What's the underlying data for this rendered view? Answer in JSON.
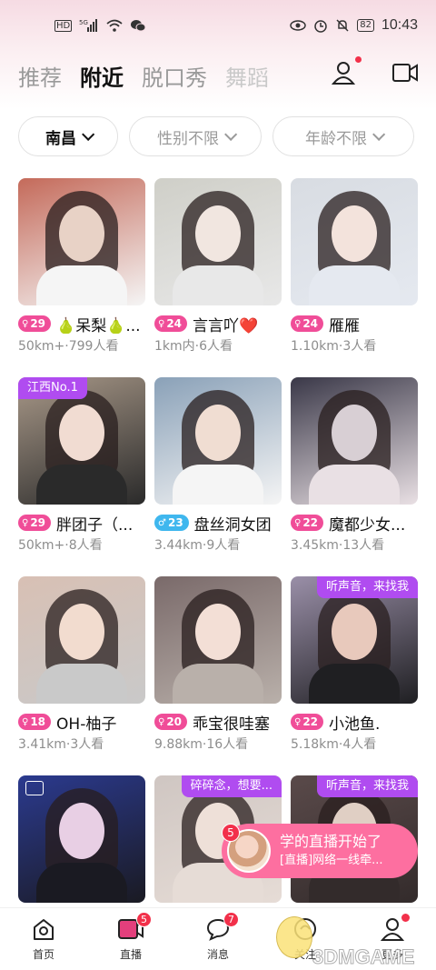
{
  "status_bar": {
    "left_icons": [
      "HD",
      "5G",
      "signal-icon",
      "wifi-icon",
      "wechat-icon"
    ],
    "battery": "82",
    "time": "10:43"
  },
  "tabs": [
    "推荐",
    "附近",
    "脱口秀",
    "舞蹈"
  ],
  "active_tab": "附近",
  "filters": {
    "city": "南昌",
    "gender": "性别不限",
    "age": "年龄不限"
  },
  "cards": [
    {
      "age": "29",
      "gender": "female",
      "name": "🍐呆梨🍐...",
      "meta": "50km+·799人看",
      "tag": "",
      "colors": [
        "#c46a5a",
        "#e8d2c6",
        "#f5f5f5"
      ]
    },
    {
      "age": "24",
      "gender": "female",
      "name": "言言吖❤️",
      "meta": "1km内·6人看",
      "tag": "",
      "colors": [
        "#cfcfc8",
        "#f1e6e0",
        "#e8e8e8"
      ]
    },
    {
      "age": "24",
      "gender": "female",
      "name": "雁雁",
      "meta": "1.10km·3人看",
      "tag": "",
      "colors": [
        "#d8dce2",
        "#f3e3dc",
        "#e5e9f0"
      ]
    },
    {
      "age": "29",
      "gender": "female",
      "name": "胖团子（...",
      "meta": "50km+·8人看",
      "tag": "江西No.1",
      "tag_side": "left",
      "colors": [
        "#a89888",
        "#f1dcd2",
        "#2a2a2a"
      ]
    },
    {
      "age": "23",
      "gender": "male",
      "name": "盘丝洞女团",
      "meta": "3.44km·9人看",
      "tag": "",
      "colors": [
        "#8aa1b8",
        "#f0ddd2",
        "#f5f5f5"
      ]
    },
    {
      "age": "22",
      "gender": "female",
      "name": "魔都少女...",
      "meta": "3.45km·13人看",
      "tag": "",
      "colors": [
        "#3a3848",
        "#d8cfd4",
        "#e9e0e4"
      ]
    },
    {
      "age": "18",
      "gender": "female",
      "name": "OH-柚子",
      "meta": "3.41km·3人看",
      "tag": "",
      "colors": [
        "#d8c0b4",
        "#f2dccf",
        "#c9c9c9"
      ]
    },
    {
      "age": "20",
      "gender": "female",
      "name": "乖宝很哇塞",
      "meta": "9.88km·16人看",
      "tag": "",
      "colors": [
        "#7a6a6a",
        "#f3dfd6",
        "#b9b0aa"
      ]
    },
    {
      "age": "22",
      "gender": "female",
      "name": "小池鱼.",
      "meta": "5.18km·4人看",
      "tag": "听声音，来找我",
      "tag_side": "right",
      "colors": [
        "#9a8fa8",
        "#e8c9bc",
        "#1f1f22"
      ]
    },
    {
      "age": "",
      "gender": "female",
      "name": "",
      "meta": "",
      "tag": "",
      "live_icon": true,
      "colors": [
        "#2b3a8f",
        "#e8cfe4",
        "#1a1a22"
      ]
    },
    {
      "age": "",
      "gender": "female",
      "name": "",
      "meta": "",
      "tag": "碎碎念，想要...",
      "tag_side": "right",
      "colors": [
        "#cfc6c2",
        "#eee0d8",
        "#e6dcd6"
      ]
    },
    {
      "age": "",
      "gender": "female",
      "name": "",
      "meta": "",
      "tag": "听声音，来找我",
      "tag_side": "right",
      "colors": [
        "#5a4a4a",
        "#e0cfc4",
        "#332b2b"
      ]
    }
  ],
  "live_popup": {
    "badge": "5",
    "title": "学的直播开始了",
    "subtitle": "[直播]网络一线牵..."
  },
  "bottom_nav": [
    {
      "label": "首页",
      "icon": "home-icon",
      "badge": ""
    },
    {
      "label": "直播",
      "icon": "live-icon",
      "badge": "5"
    },
    {
      "label": "消息",
      "icon": "message-icon",
      "badge": "7"
    },
    {
      "label": "关注",
      "icon": "follow-icon",
      "badge": ""
    },
    {
      "label": "更多",
      "icon": "more-icon",
      "badge": "dot"
    }
  ],
  "watermark": "3DMGAME",
  "accent_color": "#f04d98"
}
